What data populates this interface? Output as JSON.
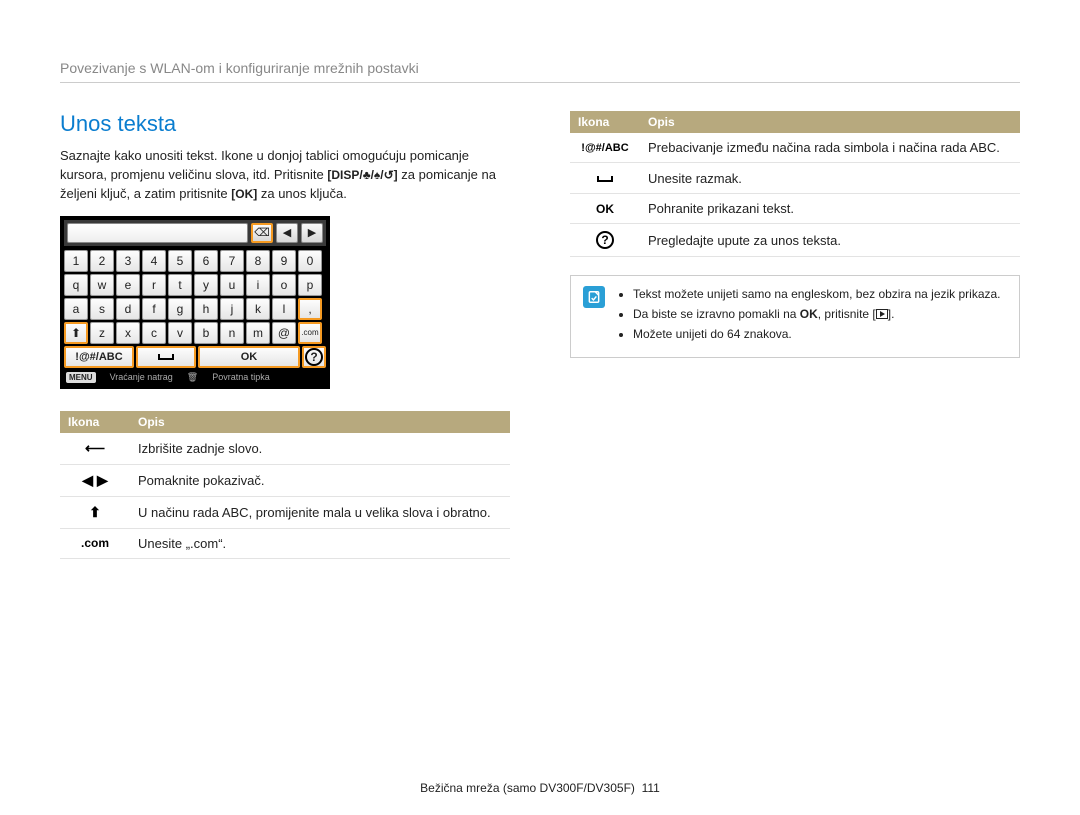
{
  "breadcrumb": "Povezivanje s WLAN-om i konfiguriranje mrežnih postavki",
  "section_title": "Unos teksta",
  "intro": {
    "l1": "Saznajte kako unositi tekst. Ikone u donjoj tablici omogućuju pomicanje kursora, promjenu veličinu slova, itd. Pritisnite",
    "keys": "[DISP/♣/♠/↺]",
    "l2": " za pomicanje na željeni ključ, a zatim pritisnite ",
    "ok": "[OK]",
    "l3": " za unos ključa."
  },
  "keyboard": {
    "rows": [
      [
        "1",
        "2",
        "3",
        "4",
        "5",
        "6",
        "7",
        "8",
        "9",
        "0"
      ],
      [
        "q",
        "w",
        "e",
        "r",
        "t",
        "y",
        "u",
        "i",
        "o",
        "p"
      ],
      [
        "a",
        "s",
        "d",
        "f",
        "g",
        "h",
        "j",
        "k",
        "l",
        ","
      ],
      [
        "⬆",
        "z",
        "x",
        "c",
        "v",
        "b",
        "n",
        "m",
        "@",
        "⌫"
      ]
    ],
    "bottom": {
      "abc": "!@#/ABC",
      "space": "␣",
      "ok": "OK",
      "help": "?"
    },
    "input_icons": [
      "⌫",
      "◀",
      "▶"
    ],
    "footer_menu": "MENU",
    "footer_back": "Vraćanje natrag",
    "footer_return": "Povratna tipka"
  },
  "table1": {
    "h1": "Ikona",
    "h2": "Opis",
    "rows": [
      {
        "icon": "⟵",
        "desc": "Izbrišite zadnje slovo."
      },
      {
        "icon": "◀ ▶",
        "desc": "Pomaknite pokazivač."
      },
      {
        "icon": "⬆",
        "desc": "U načinu rada ABC, promijenite mala u velika slova i obratno."
      },
      {
        "icon": ".com",
        "desc": "Unesite „.com“."
      }
    ]
  },
  "table2": {
    "h1": "Ikona",
    "h2": "Opis",
    "rows": [
      {
        "icon": "!@#/ABC",
        "desc": "Prebacivanje između načina rada simbola i načina rada ABC."
      },
      {
        "icon": "space",
        "desc": "Unesite razmak."
      },
      {
        "icon": "OK",
        "desc": "Pohranite prikazani tekst."
      },
      {
        "icon": "help",
        "desc": "Pregledajte upute za unos teksta."
      }
    ]
  },
  "notes": {
    "n1": "Tekst možete unijeti samo na engleskom, bez obzira na jezik prikaza.",
    "n2a": "Da biste se izravno pomakli na ",
    "n2b": "OK",
    "n2c": ", pritisnite [",
    "n2d": "].",
    "n3": "Možete unijeti do 64 znakova."
  },
  "footer": {
    "text": "Bežična mreža (samo DV300F/DV305F)",
    "page": "111"
  }
}
